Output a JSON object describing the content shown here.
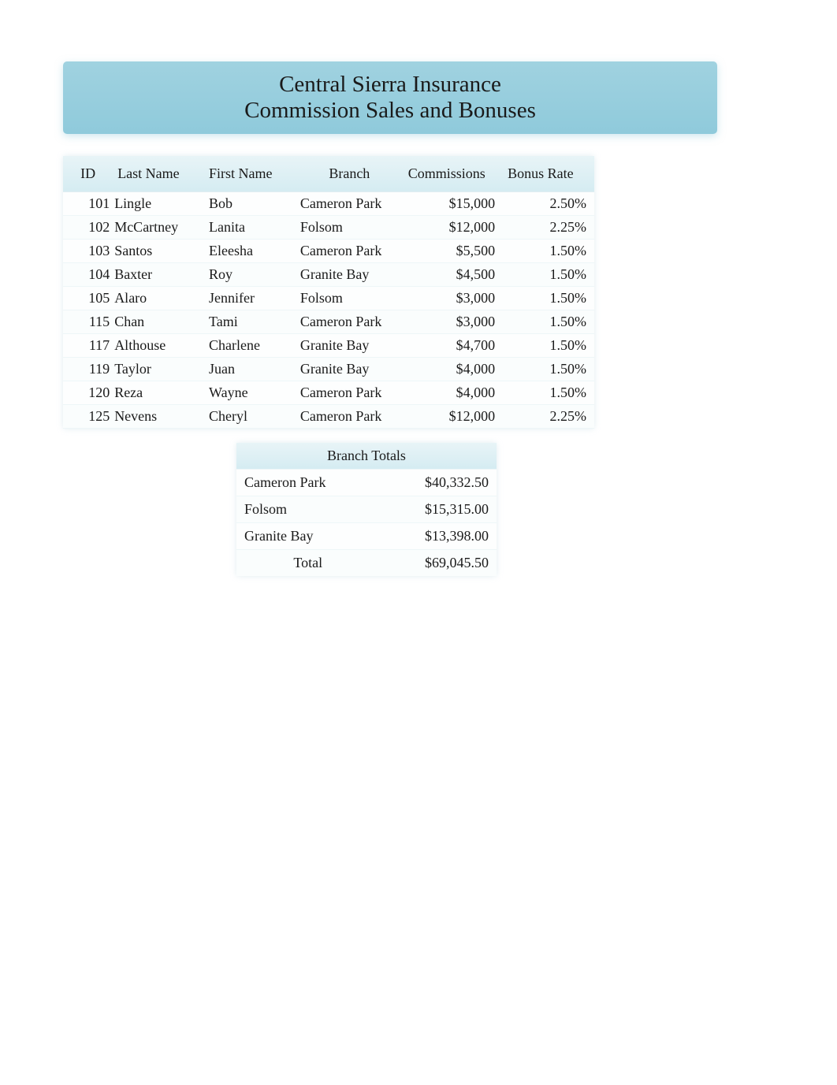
{
  "title": {
    "line1": "Central Sierra Insurance",
    "line2": "Commission Sales and Bonuses"
  },
  "headers": {
    "id": "ID",
    "last": "Last Name",
    "first": "First Name",
    "branch": "Branch",
    "commissions": "Commissions",
    "rate": "Bonus Rate"
  },
  "rows": [
    {
      "id": "101",
      "last": "Lingle",
      "first": "Bob",
      "branch": "Cameron Park",
      "commissions": "$15,000",
      "rate": "2.50%"
    },
    {
      "id": "102",
      "last": "McCartney",
      "first": "Lanita",
      "branch": "Folsom",
      "commissions": "$12,000",
      "rate": "2.25%"
    },
    {
      "id": "103",
      "last": "Santos",
      "first": "Eleesha",
      "branch": "Cameron Park",
      "commissions": "$5,500",
      "rate": "1.50%"
    },
    {
      "id": "104",
      "last": "Baxter",
      "first": "Roy",
      "branch": "Granite Bay",
      "commissions": "$4,500",
      "rate": "1.50%"
    },
    {
      "id": "105",
      "last": "Alaro",
      "first": "Jennifer",
      "branch": "Folsom",
      "commissions": "$3,000",
      "rate": "1.50%"
    },
    {
      "id": "115",
      "last": "Chan",
      "first": "Tami",
      "branch": "Cameron Park",
      "commissions": "$3,000",
      "rate": "1.50%"
    },
    {
      "id": "117",
      "last": "Althouse",
      "first": "Charlene",
      "branch": "Granite Bay",
      "commissions": "$4,700",
      "rate": "1.50%"
    },
    {
      "id": "119",
      "last": "Taylor",
      "first": "Juan",
      "branch": "Granite Bay",
      "commissions": "$4,000",
      "rate": "1.50%"
    },
    {
      "id": "120",
      "last": "Reza",
      "first": "Wayne",
      "branch": "Cameron Park",
      "commissions": "$4,000",
      "rate": "1.50%"
    },
    {
      "id": "125",
      "last": "Nevens",
      "first": "Cheryl",
      "branch": "Cameron Park",
      "commissions": "$12,000",
      "rate": "2.25%"
    }
  ],
  "totals": {
    "header": "Branch Totals",
    "rows": [
      {
        "branch": "Cameron Park",
        "amount": "$40,332.50"
      },
      {
        "branch": "Folsom",
        "amount": "$15,315.00"
      },
      {
        "branch": "Granite Bay",
        "amount": "$13,398.00"
      }
    ],
    "total_label": "Total",
    "total_amount": "$69,045.50"
  }
}
